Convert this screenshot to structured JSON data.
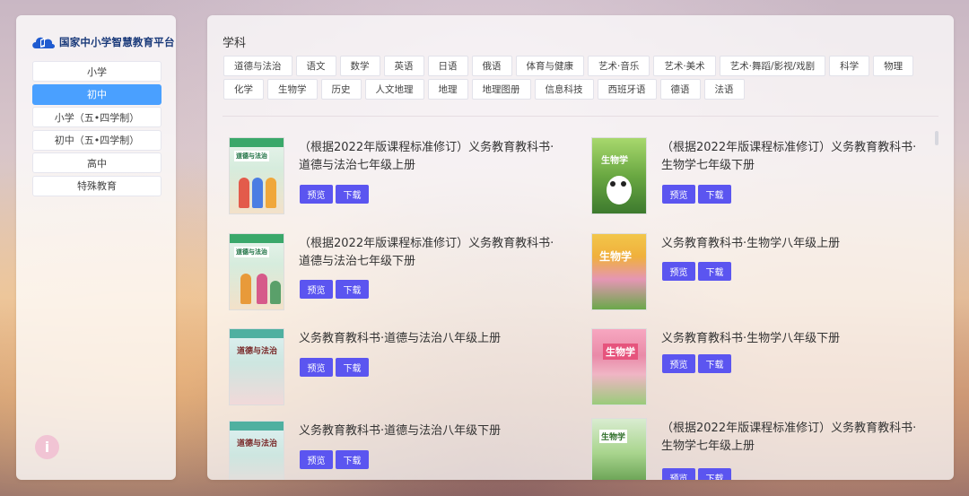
{
  "platform": {
    "name": "国家中小学智慧教育平台"
  },
  "sidebar": {
    "items": [
      {
        "label": "小学",
        "active": false
      },
      {
        "label": "初中",
        "active": true
      },
      {
        "label": "小学（五•四学制）",
        "active": false
      },
      {
        "label": "初中（五•四学制）",
        "active": false
      },
      {
        "label": "高中",
        "active": false
      },
      {
        "label": "特殊教育",
        "active": false
      }
    ]
  },
  "filters": {
    "title": "学科",
    "subjects": [
      "道德与法治",
      "语文",
      "数学",
      "英语",
      "日语",
      "俄语",
      "体育与健康",
      "艺术·音乐",
      "艺术·美术",
      "艺术·舞蹈/影视/戏剧",
      "科学",
      "物理",
      "化学",
      "生物学",
      "历史",
      "人文地理",
      "地理",
      "地理图册",
      "信息科技",
      "西班牙语",
      "德语",
      "法语"
    ]
  },
  "books": [
    {
      "title": "（根据2022年版课程标准修订）义务教育教科书·道德与法治七年级上册",
      "cover": "道德与法治",
      "preview": "预览",
      "download": "下载"
    },
    {
      "title": "（根据2022年版课程标准修订）义务教育教科书·生物学七年级下册",
      "cover": "生物学",
      "preview": "预览",
      "download": "下载"
    },
    {
      "title": "（根据2022年版课程标准修订）义务教育教科书·道德与法治七年级下册",
      "cover": "道德与法治",
      "preview": "预览",
      "download": "下载"
    },
    {
      "title": "义务教育教科书·生物学八年级上册",
      "cover": "生物学",
      "preview": "预览",
      "download": "下载"
    },
    {
      "title": "义务教育教科书·道德与法治八年级上册",
      "cover": "道德与法治",
      "preview": "预览",
      "download": "下载"
    },
    {
      "title": "义务教育教科书·生物学八年级下册",
      "cover": "生物学",
      "preview": "预览",
      "download": "下载"
    },
    {
      "title": "义务教育教科书·道德与法治八年级下册",
      "cover": "道德与法治",
      "preview": "预览",
      "download": "下载"
    },
    {
      "title": "（根据2022年版课程标准修订）义务教育教科书·生物学七年级上册",
      "cover": "生物学",
      "preview": "预览",
      "download": "下载"
    }
  ],
  "icons": {
    "logo": "cloud-book-logo-icon",
    "info": "info-icon"
  },
  "colors": {
    "active_nav": "#4aa0ff",
    "action_button": "#5b55f0"
  }
}
